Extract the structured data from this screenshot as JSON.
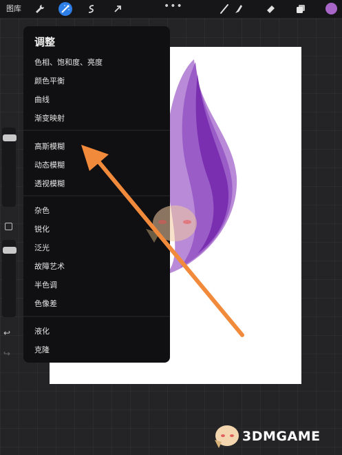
{
  "topbar": {
    "gallery_label": "图库",
    "more_label": "•••",
    "tools": [
      "wrench-icon",
      "magic-wand-icon",
      "selection-icon",
      "transform-icon",
      "brush-icon",
      "smudge-icon",
      "eraser-icon",
      "layers-icon"
    ],
    "active_color": "#a866c9",
    "active_tool_color": "#2f7fe8"
  },
  "menu": {
    "title": "调整",
    "groups": [
      [
        "色相、饱和度、亮度",
        "颜色平衡",
        "曲线",
        "渐变映射"
      ],
      [
        "高斯模糊",
        "动态模糊",
        "透视模糊"
      ],
      [
        "杂色",
        "锐化",
        "泛光",
        "故障艺术",
        "半色调",
        "色像差"
      ],
      [
        "液化",
        "克隆"
      ]
    ]
  },
  "sidebar": {
    "undo": "↩",
    "redo": "↪"
  },
  "watermark": {
    "text": "3DMGAME"
  },
  "colors": {
    "flame_light": "#b98ad8",
    "flame_mid": "#9a5cc7",
    "flame_dark": "#7a2fb0",
    "annotation_arrow": "#f28a3c"
  }
}
